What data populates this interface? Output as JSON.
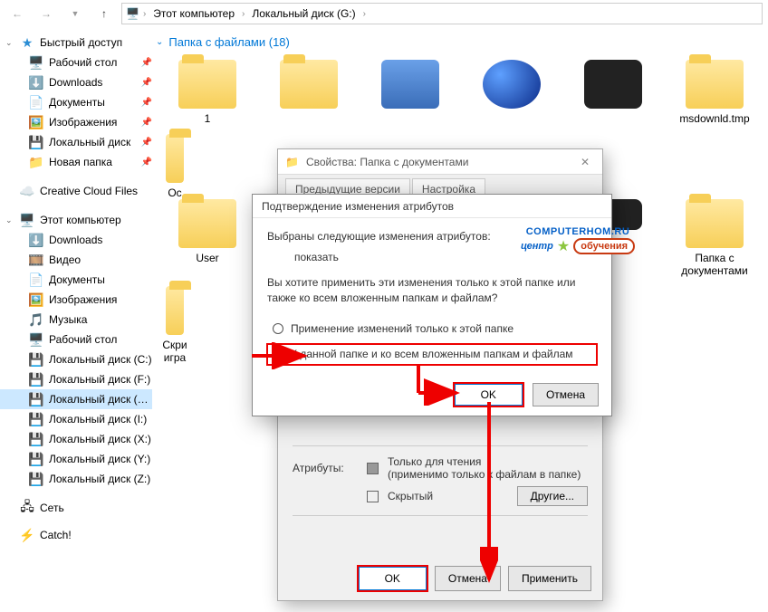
{
  "breadcrumb": {
    "item1": "Этот компьютер",
    "item2": "Локальный диск (G:)"
  },
  "content_header": {
    "title": "Папка с файлами (18)"
  },
  "sidebar": {
    "quick_access": "Быстрый доступ",
    "items_qa": [
      "Рабочий стол",
      "Downloads",
      "Документы",
      "Изображения",
      "Локальный диск",
      "Новая папка"
    ],
    "creative_cloud": "Creative Cloud Files",
    "this_pc": "Этот компьютер",
    "items_pc": [
      "Downloads",
      "Видео",
      "Документы",
      "Изображения",
      "Музыка",
      "Рабочий стол",
      "Локальный диск (C:)",
      "Локальный диск (F:)",
      "Локальный диск (G:)",
      "Локальный диск (I:)",
      "Локальный диск (X:)",
      "Локальный диск (Y:)",
      "Локальный диск (Z:)"
    ],
    "network": "Сеть",
    "catch": "Catch!"
  },
  "folders": {
    "f1": "1",
    "f2": "User",
    "f3": "msdownld.tmp",
    "f4": "Oc",
    "f5": "Папка с документами",
    "f6": "Скри игра"
  },
  "props": {
    "title": "Свойства: Папка с документами",
    "tab1": "Предыдущие версии",
    "tab2": "Настройка",
    "attr_label": "Атрибуты:",
    "readonly": "Только для чтения",
    "readonly_note": "(применимо только к файлам в папке)",
    "hidden": "Скрытый",
    "other": "Другие...",
    "ok": "OK",
    "cancel": "Отмена",
    "apply": "Применить"
  },
  "confirm": {
    "title": "Подтверждение изменения атрибутов",
    "msg1": "Выбраны следующие изменения атрибутов:",
    "change": "показать",
    "msg2": "Вы хотите применить эти изменения только к этой папке или также ко всем вложенным папкам и файлам?",
    "opt1": "Применение изменений только к этой папке",
    "opt2": "К данной папке и ко всем вложенным папкам и файлам",
    "ok": "OK",
    "cancel": "Отмена"
  },
  "watermark": {
    "top": "COMPUTERHOM.RU",
    "mid1": "центр",
    "mid2": "обучения"
  }
}
